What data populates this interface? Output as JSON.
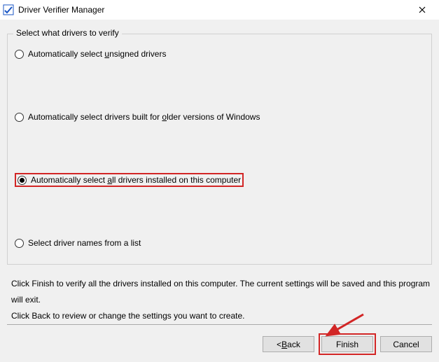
{
  "titlebar": {
    "title": "Driver Verifier Manager"
  },
  "group": {
    "legend": "Select what drivers to verify",
    "options": {
      "unsigned_pre": "Automatically select ",
      "unsigned_u": "u",
      "unsigned_post": "nsigned drivers",
      "older_pre": "Automatically select drivers built for ",
      "older_u": "o",
      "older_post": "lder versions of Windows",
      "all_pre": "Automatically select ",
      "all_u": "a",
      "all_post": "ll drivers installed on this computer",
      "list_text": "Select driver names from a list"
    }
  },
  "instructions": {
    "line1": "Click Finish to verify all the drivers installed on this computer. The current settings will be saved and this program will exit.",
    "line2": "Click Back to review or change the settings you want to create."
  },
  "buttons": {
    "back_pre": "< ",
    "back_u": "B",
    "back_post": "ack",
    "finish": "Finish",
    "cancel": "Cancel"
  }
}
